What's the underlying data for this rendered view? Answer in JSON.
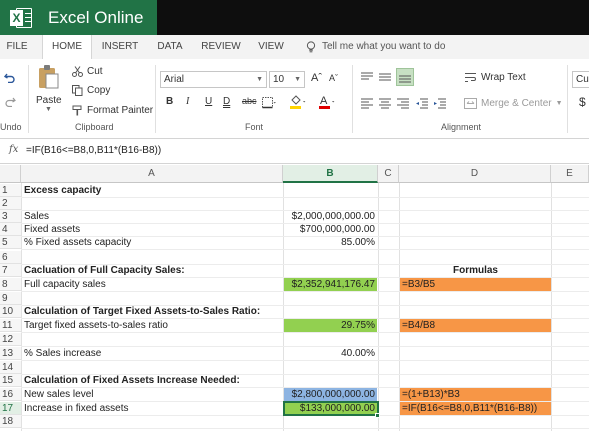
{
  "app": {
    "title": "Excel Online",
    "brand_color": "#217346"
  },
  "menu": {
    "tabs": [
      {
        "label": "FILE"
      },
      {
        "label": "HOME"
      },
      {
        "label": "INSERT"
      },
      {
        "label": "DATA"
      },
      {
        "label": "REVIEW"
      },
      {
        "label": "VIEW"
      }
    ],
    "active_tab": "HOME",
    "tell_me": "Tell me what you want to do"
  },
  "ribbon": {
    "undo": "Undo",
    "clipboard": {
      "paste": "Paste",
      "cut": "Cut",
      "copy": "Copy",
      "format_painter": "Format Painter",
      "label": "Clipboard"
    },
    "font": {
      "name": "Arial",
      "size": "10",
      "label": "Font"
    },
    "alignment": {
      "wrap_text": "Wrap Text",
      "merge_center": "Merge & Center",
      "label": "Alignment"
    },
    "number_format": "Cur",
    "currency_symbol": "$"
  },
  "formula_bar": {
    "fx": "fx",
    "formula": "=IF(B16<=B8,0,B11*(B16-B8))"
  },
  "grid": {
    "columns": [
      "A",
      "B",
      "C",
      "D",
      "E"
    ],
    "selected_column": "B",
    "selected_row": "17",
    "rows": [
      "1",
      "2",
      "3",
      "4",
      "5",
      "6",
      "7",
      "8",
      "9",
      "10",
      "11",
      "12",
      "13",
      "14",
      "15",
      "16",
      "17",
      "18"
    ],
    "cells": {
      "a1": "Excess capacity",
      "a3": "Sales",
      "b3": "$2,000,000,000.00",
      "a4": "Fixed assets",
      "b4": "$700,000,000.00",
      "a5": "% Fixed assets capacity",
      "b5": "85.00%",
      "a7": "Cacluation of Full Capacity Sales:",
      "d7": "Formulas",
      "a8": "Full capacity sales",
      "b8": "$2,352,941,176.47",
      "d8": "=B3/B5",
      "a10": "Calculation of Target Fixed Assets-to-Sales Ratio:",
      "a11": "Target fixed assets-to-sales ratio",
      "b11": "29.75%",
      "d11": "=B4/B8",
      "a13": "% Sales increase",
      "b13": "40.00%",
      "a15": "Calculation of Fixed Assets Increase Needed:",
      "a16": "New sales level",
      "b16": "$2,800,000,000.00",
      "d16": "=(1+B13)*B3",
      "a17": "Increase in fixed assets",
      "b17": "$133,000,000.00",
      "d17": "=IF(B16<=B8,0,B11*(B16-B8))"
    },
    "colors": {
      "green_fill": "#92d050",
      "orange_fill": "#f79646",
      "blue_fill": "#8db4e2"
    }
  }
}
